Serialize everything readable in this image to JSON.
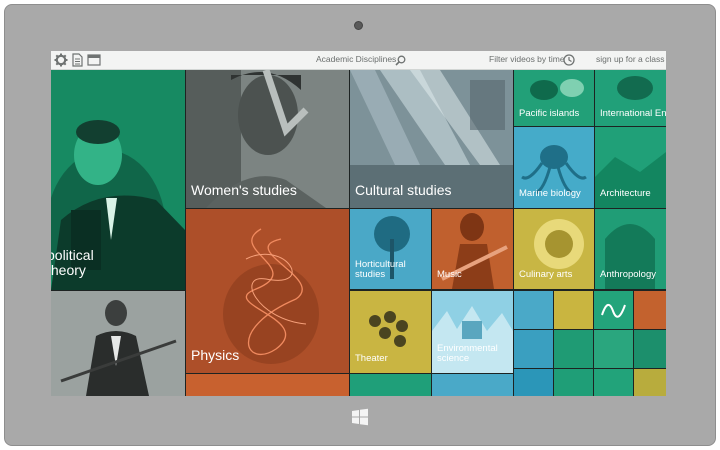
{
  "toolbar": {
    "search_label": "Academic Disciplines",
    "filter_label": "Filter videos by time",
    "signup_label": "sign up for a class"
  },
  "icons": [
    "gear-icon",
    "document-icon",
    "window-icon",
    "search-icon",
    "clock-icon",
    "windows-logo-icon"
  ],
  "tiles": {
    "political_theory": "political theory",
    "womens_studies": "Women's studies",
    "cultural_studies": "Cultural studies",
    "pacific_islands": "Pacific islands",
    "international": "International En",
    "marine_biology": "Marine biology",
    "architecture": "Architecture",
    "physics": "Physics",
    "horticultural": "Horticultural studies",
    "music": "Music",
    "culinary_arts": "Culinary arts",
    "anthropology": "Anthropology",
    "theater": "Theater",
    "environmental": "Environmental science"
  },
  "colors": {
    "bezel": "#a9a9a9",
    "green": "#1fa67a",
    "orange": "#b3532a",
    "blue": "#4aa9c8",
    "yellow": "#c9b640",
    "grey": "#7f8785"
  }
}
